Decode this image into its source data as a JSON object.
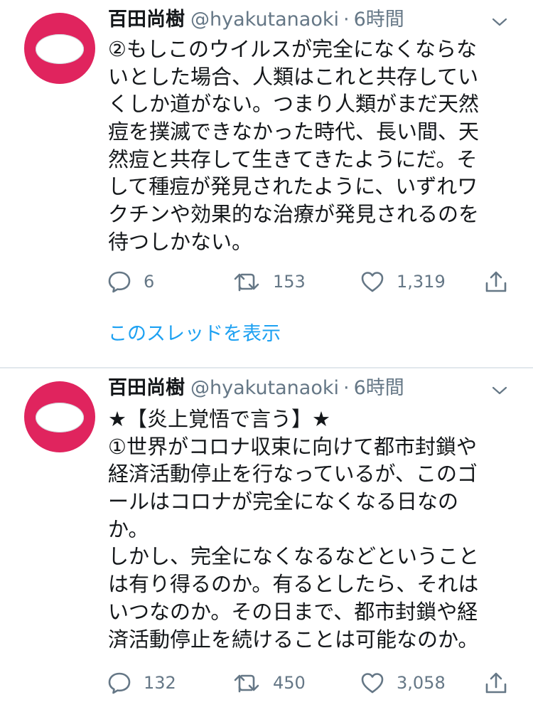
{
  "tweets": [
    {
      "author_name": "百田尚樹",
      "handle": "@hyakutanaoki",
      "separator": "·",
      "time": "6時間",
      "text_lines": [
        "②もしこのウイルスが完全になくならな",
        "いとした場合、人類はこれと共存してい",
        "くしか道がない。つまり人類がまだ天然",
        "痘を撲滅できなかった時代、長い間、天",
        "然痘と共存して生きてきたようにだ。そ",
        "して種痘が発見されたように、いずれワ",
        "クチンや効果的な治療が発見されるのを",
        "待つしかない。"
      ],
      "reply_count": "6",
      "retweet_count": "153",
      "like_count": "1,319",
      "thread_link": "このスレッドを表示"
    },
    {
      "author_name": "百田尚樹",
      "handle": "@hyakutanaoki",
      "separator": "·",
      "time": "6時間",
      "text_lines": [
        "★【炎上覚悟で言う】★",
        "①世界がコロナ収束に向けて都市封鎖や",
        "経済活動停止を行なっているが、このゴ",
        "ールはコロナが完全になくなる日なの",
        "か。",
        "しかし、完全になくなるなどということ",
        "は有り得るのか。有るとしたら、それは",
        "いつなのか。その日まで、都市封鎖や経",
        "済活動停止を続けることは可能なのか。"
      ],
      "reply_count": "132",
      "retweet_count": "450",
      "like_count": "3,058"
    }
  ],
  "icons": {
    "avatar": "red-circle-avatar",
    "caret": "chevron-down-icon",
    "reply": "reply-icon",
    "retweet": "retweet-icon",
    "like": "heart-icon",
    "share": "share-icon"
  },
  "colors": {
    "avatar_red": "#e0245e",
    "link_blue": "#1da1f2",
    "secondary_gray": "#657786",
    "divider": "#e1e8ed"
  }
}
